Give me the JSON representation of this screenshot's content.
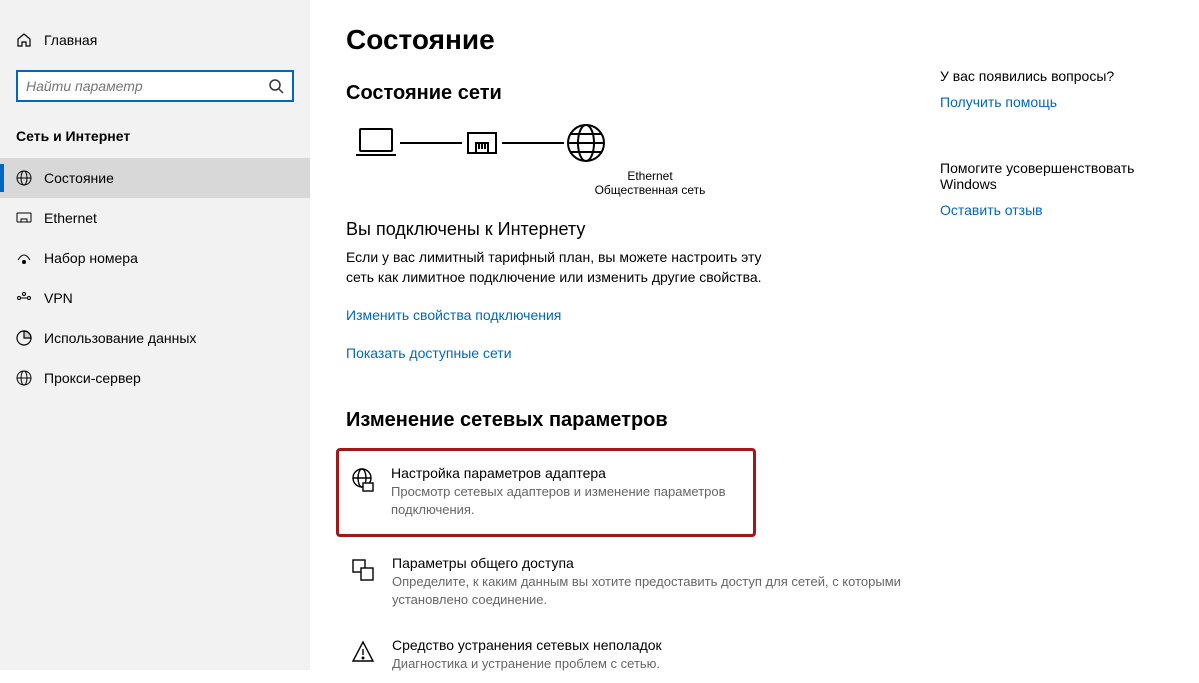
{
  "sidebar": {
    "home": "Главная",
    "search_placeholder": "Найти параметр",
    "category": "Сеть и Интернет",
    "items": [
      {
        "label": "Состояние"
      },
      {
        "label": "Ethernet"
      },
      {
        "label": "Набор номера"
      },
      {
        "label": "VPN"
      },
      {
        "label": "Использование данных"
      },
      {
        "label": "Прокси-сервер"
      }
    ]
  },
  "main": {
    "title": "Состояние",
    "network_state_heading": "Состояние сети",
    "diagram": {
      "ethernet_label": "Ethernet",
      "network_type": "Общественная сеть"
    },
    "connected_heading": "Вы подключены к Интернету",
    "connected_desc": "Если у вас лимитный тарифный план, вы можете настроить эту сеть как лимитное подключение или изменить другие свойства.",
    "link_change_props": "Изменить свойства подключения",
    "link_show_nets": "Показать доступные сети",
    "change_params_heading": "Изменение сетевых параметров",
    "options": [
      {
        "title": "Настройка параметров адаптера",
        "desc": "Просмотр сетевых адаптеров и изменение параметров подключения."
      },
      {
        "title": "Параметры общего доступа",
        "desc": "Определите, к каким данным вы хотите предоставить доступ для сетей, с которыми установлено соединение."
      },
      {
        "title": "Средство устранения сетевых неполадок",
        "desc": "Диагностика и устранение проблем с сетью."
      }
    ]
  },
  "right": {
    "q1": "У вас появились вопросы?",
    "link1": "Получить помощь",
    "q2": "Помогите усовершенствовать Windows",
    "link2": "Оставить отзыв"
  }
}
